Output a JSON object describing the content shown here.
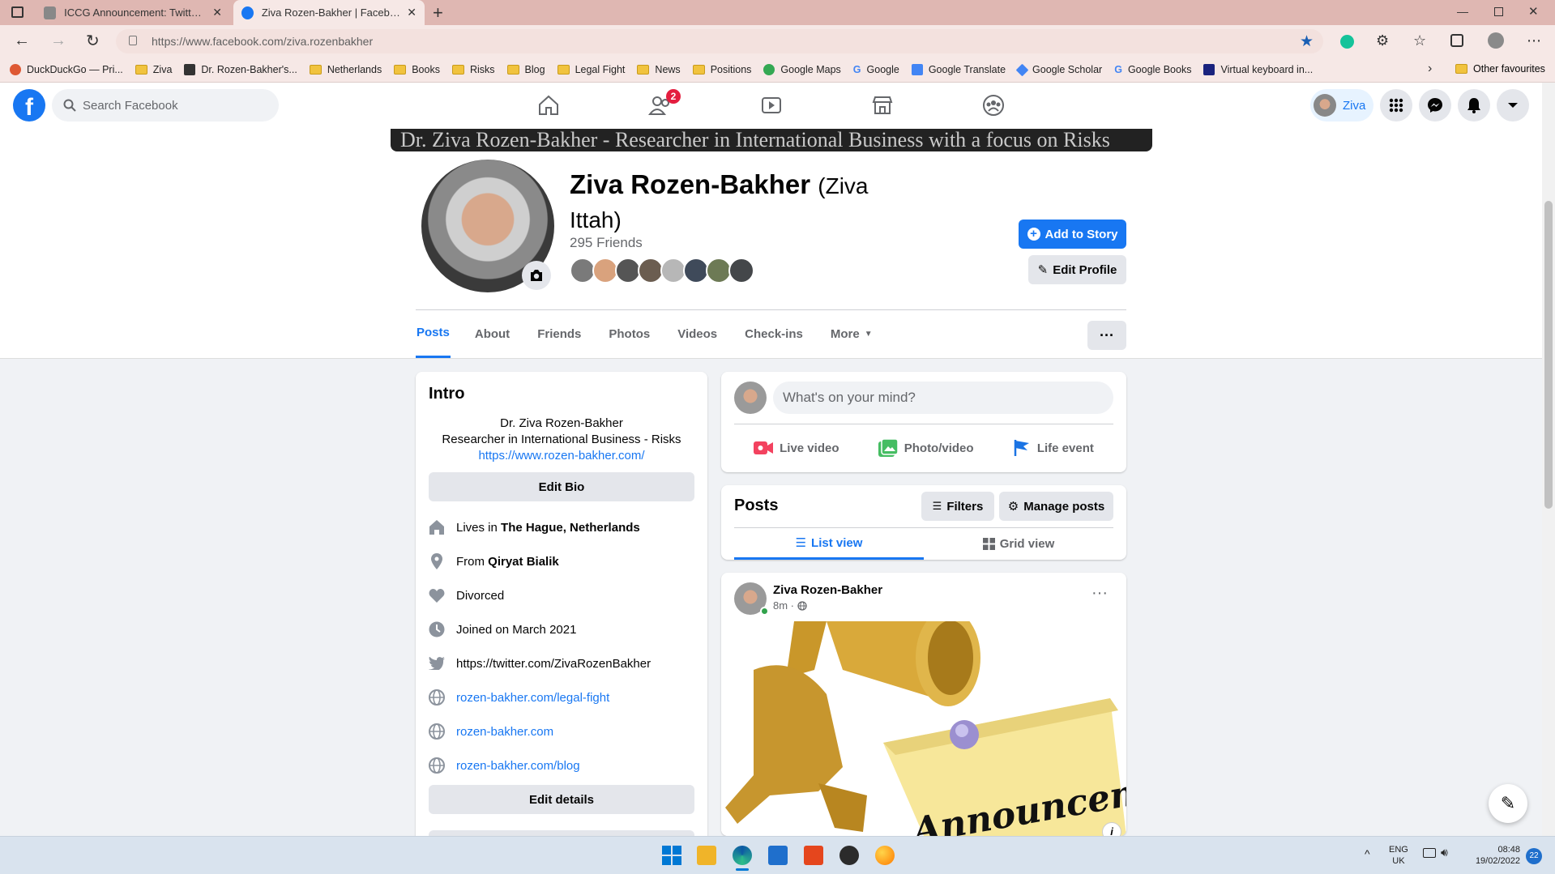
{
  "browser": {
    "tabs": [
      {
        "title": "ICCG Announcement: Twitter Cy",
        "active": false
      },
      {
        "title": "Ziva Rozen-Bakher | Facebook",
        "active": true
      }
    ],
    "url": "https://www.facebook.com/ziva.rozenbakher",
    "bookmarks": [
      "DuckDuckGo — Pri...",
      "Ziva",
      "Dr. Rozen-Bakher's...",
      "Netherlands",
      "Books",
      "Risks",
      "Blog",
      "Legal Fight",
      "News",
      "Positions",
      "Google Maps",
      "Google",
      "Google Translate",
      "Google Scholar",
      "Google Books",
      "Virtual keyboard in..."
    ],
    "other_favourites": "Other favourites"
  },
  "fb": {
    "search_placeholder": "Search Facebook",
    "friends_badge": "2",
    "user_chip": "Ziva",
    "brand_color": "#1877f2"
  },
  "profile": {
    "cover_text": "Dr. Ziva Rozen-Bakher - Researcher in International Business with a focus on Risks",
    "name": "Ziva Rozen-Bakher",
    "alt_name": "(Ziva Ittah)",
    "friends_count": "295 Friends",
    "add_story": "Add to Story",
    "edit_profile": "Edit Profile",
    "tabs": [
      "Posts",
      "About",
      "Friends",
      "Photos",
      "Videos",
      "Check-ins",
      "More"
    ]
  },
  "intro": {
    "heading": "Intro",
    "bio_line1": "Dr. Ziva Rozen-Bakher",
    "bio_line2": "Researcher in International Business - Risks",
    "bio_link": "https://www.rozen-bakher.com/",
    "edit_bio": "Edit Bio",
    "lives_prefix": "Lives in",
    "lives": "The Hague, Netherlands",
    "from_prefix": "From",
    "from": "Qiryat Bialik",
    "relationship": "Divorced",
    "joined": "Joined on March 2021",
    "twitter": "https://twitter.com/ZivaRozenBakher",
    "site1": "rozen-bakher.com/legal-fight",
    "site2": "rozen-bakher.com",
    "site3": "rozen-bakher.com/blog",
    "edit_details": "Edit details"
  },
  "composer": {
    "placeholder": "What's on your mind?",
    "live": "Live video",
    "photo": "Photo/video",
    "life": "Life event"
  },
  "posts_header": {
    "title": "Posts",
    "filters": "Filters",
    "manage": "Manage posts",
    "list_view": "List view",
    "grid_view": "Grid view"
  },
  "post": {
    "author": "Ziva Rozen-Bakher",
    "time": "8m",
    "image_text": "Announcement!"
  },
  "taskbar": {
    "lang1": "ENG",
    "lang2": "UK",
    "time": "08:48",
    "date": "19/02/2022",
    "notif": "22"
  }
}
